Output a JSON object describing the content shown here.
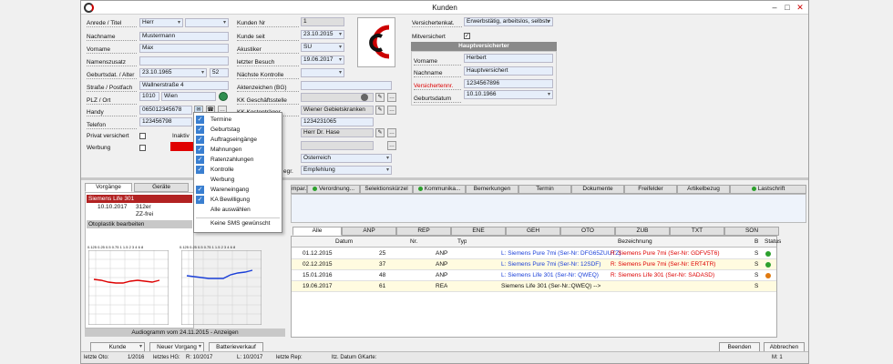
{
  "window": {
    "title": "Kunden"
  },
  "form": {
    "anrede_label": "Anrede / Titel",
    "anrede": "Herr",
    "nachname_label": "Nachname",
    "nachname": "Mustermann",
    "vorname_label": "Vorname",
    "vorname": "Max",
    "namenszusatz_label": "Namenszusatz",
    "geburt_label": "Geburtsdat. / Alter",
    "geburt": "23.10.1965",
    "alter": "52",
    "strasse_label": "Straße / Postfach",
    "strasse": "Wallnerstraße 4",
    "plz_label": "PLZ / Ort",
    "plz": "1010",
    "ort": "Wien",
    "handy_label": "Handy",
    "handy": "065012345678",
    "telefon_label": "Telefon",
    "telefon": "123456798",
    "privat_label": "Privat versichert",
    "inaktiv_label": "Inaktiv",
    "werbung_label": "Werbung"
  },
  "middle": {
    "kundennr_label": "Kunden Nr",
    "kundennr": "1",
    "seit_label": "Kunde seit",
    "seit": "23.10.2015",
    "akustiker_label": "Akustiker",
    "akustiker": "SU",
    "besuch_label": "letzter Besuch",
    "besuch": "19.06.2017",
    "kontrolle_label": "Nächste Kontrolle",
    "akten_label": "Aktenzeichen (BG)",
    "kkgs_label": "KK Geschäftsstelle",
    "kktraeger_label": "KK Kostenträger",
    "kktraeger": "Wiener Gebietskranken",
    "vnr": "1234231065",
    "arzt": "Herr Dr. Hase",
    "land": "Österreich",
    "empf_label": "egr.",
    "empf": "Empfehlung"
  },
  "right": {
    "vkat_label": "Versichertenkat.",
    "vkat": "Erwerbstätig, arbeitslos, selbstv",
    "mitvers_label": "Mitversichert",
    "hv_title": "Hauptversicherter",
    "vorname_label": "Vorname",
    "vorname": "Herbert",
    "nachname_label": "Nachname",
    "nachname": "Hauptversichert",
    "vnr_label": "Versichertennr.",
    "vnr": "1234567896",
    "geb_label": "Geburtsdatum",
    "geb": "10.10.1966"
  },
  "menu": {
    "items": [
      {
        "label": "Termine",
        "checked": true
      },
      {
        "label": "Geburtstag",
        "checked": true
      },
      {
        "label": "Auftragseingänge",
        "checked": true
      },
      {
        "label": "Mahnungen",
        "checked": true
      },
      {
        "label": "Ratenzahlungen",
        "checked": true
      },
      {
        "label": "Kontrolle",
        "checked": true
      },
      {
        "label": "Werbung",
        "checked": false
      },
      {
        "label": "Wareneingang",
        "checked": true
      },
      {
        "label": "KA Bewilligung",
        "checked": true
      },
      {
        "label": "Alle auswählen",
        "checked": false
      },
      {
        "label": "Keine SMS gewünscht",
        "checked": false
      }
    ]
  },
  "lefttabs": [
    "Vorgänge",
    "Geräte"
  ],
  "device": {
    "title": "Siemens Life 301",
    "date": "10.10.2017",
    "val1": "312er",
    "val2": "ZZ-frei",
    "otoplastik": "Otoplastik bearbeiten"
  },
  "audiogram": {
    "caption": "Audiogramm vom 24.11.2015 - Anzeigen",
    "freq": "0.125  0.25  0.5  0.75  1  1.5  2  3  4  6  8"
  },
  "toptabs": [
    "mpar...",
    "Verordnung...",
    "Selektionskürzel",
    "Kommunika...",
    "Bemerkungen",
    "Termin",
    "Dokumente",
    "Freifelder",
    "Artikelbezug",
    "Lastschrift"
  ],
  "filtertabs": [
    "Alle",
    "ANP",
    "REP",
    "ENE",
    "GEH",
    "OTO",
    "ZUB",
    "TXT",
    "SON"
  ],
  "table": {
    "headers": {
      "datum": "Datum",
      "nr": "Nr.",
      "typ": "Typ",
      "bez": "Bezeichnung",
      "b": "B",
      "status": "Status"
    },
    "rows": [
      {
        "datum": "01.12.2015",
        "nr": "25",
        "typ": "ANP",
        "l": "L: Siemens Pure 7mi (Ser-Nr: DFG65ZUUTZ)",
        "r": "R: Siemens Pure 7mi (Ser-Nr: GDFV5T6)",
        "b": "S",
        "status": "#2ca02c",
        "bg": "#ffffff"
      },
      {
        "datum": "02.12.2015",
        "nr": "37",
        "typ": "ANP",
        "l": "L: Siemens Pure 7mi (Ser-Nr: 12SDF)",
        "r": "R: Siemens Pure 7mi (Ser-Nr: ERT4TR)",
        "b": "S",
        "status": "#2ca02c",
        "bg": "#fffbe0"
      },
      {
        "datum": "15.01.2016",
        "nr": "48",
        "typ": "ANP",
        "l": "L: Siemens Life 301 (Ser-Nr: QWEQ)",
        "r": "R: Siemens Life 301 (Ser-Nr: SADASD)",
        "b": "S",
        "status": "#e07a10",
        "bg": "#ffffff"
      },
      {
        "datum": "19.06.2017",
        "nr": "61",
        "typ": "REA",
        "l": "Siemens Life 301 (Ser-Nr.:QWEQ) -->",
        "r": "",
        "b": "S",
        "status": "",
        "bg": "#fffbe0"
      }
    ]
  },
  "footer": {
    "kunde": "Kunde",
    "neuer_vorgang": "Neuer Vorgang",
    "batterie": "Batterieverkauf",
    "beenden": "Beenden",
    "abbrechen": "Abbrechen"
  },
  "statusbar": {
    "oto_label": "letzte Oto:",
    "oto": "1/2016",
    "hg_label": "letztes HG:",
    "r": "R: 10/2017",
    "l": "L: 10/2017",
    "rep_label": "letzte Rep:",
    "gkarte": "ltz. Datum GKarte:",
    "m": "M: 1"
  }
}
